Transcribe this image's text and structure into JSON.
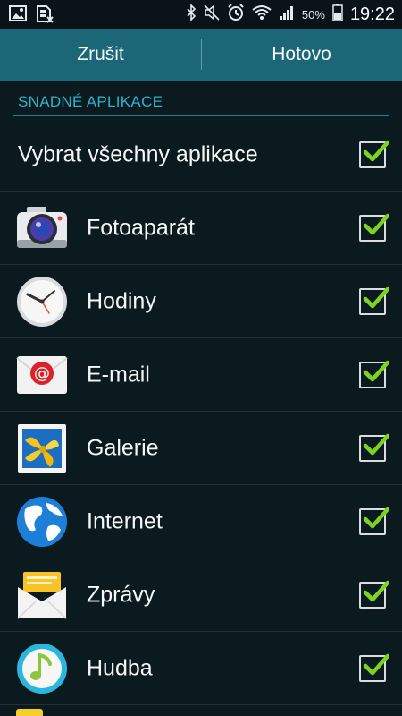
{
  "status_bar": {
    "battery": "50%",
    "time": "19:22",
    "icons": [
      "image-icon",
      "sim-card-icon",
      "bluetooth-icon",
      "mute-icon",
      "alarm-icon",
      "wifi-icon",
      "signal-icon",
      "battery-icon"
    ]
  },
  "action_bar": {
    "cancel_label": "Zrušit",
    "done_label": "Hotovo"
  },
  "section": {
    "title": "SNADNÉ APLIKACE"
  },
  "select_all": {
    "label": "Vybrat všechny aplikace",
    "checked": true
  },
  "apps": [
    {
      "label": "Fotoaparát",
      "icon": "camera-icon",
      "checked": true
    },
    {
      "label": "Hodiny",
      "icon": "clock-icon",
      "checked": true
    },
    {
      "label": "E-mail",
      "icon": "email-icon",
      "checked": true
    },
    {
      "label": "Galerie",
      "icon": "gallery-icon",
      "checked": true
    },
    {
      "label": "Internet",
      "icon": "globe-icon",
      "checked": true
    },
    {
      "label": "Zprávy",
      "icon": "messages-icon",
      "checked": true
    },
    {
      "label": "Hudba",
      "icon": "music-icon",
      "checked": true
    }
  ],
  "colors": {
    "background": "#0b1a1f",
    "action_bar": "#1b6677",
    "section_text": "#2bb4cf",
    "check_green": "#7ed321"
  }
}
